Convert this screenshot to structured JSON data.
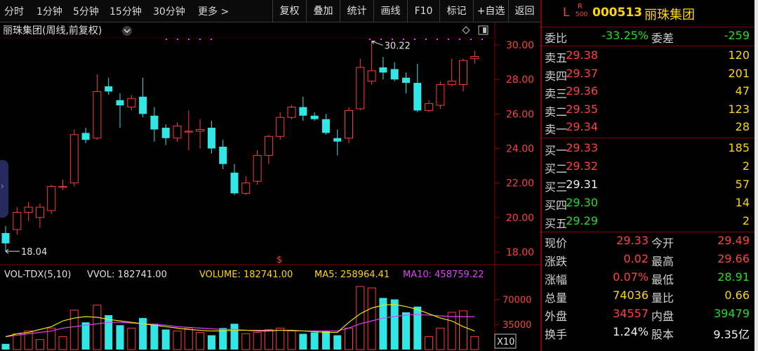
{
  "toolbar": {
    "periods": [
      "分时",
      "1分钟",
      "5分钟",
      "15分钟",
      "30分钟",
      "更多 >"
    ],
    "buttons": [
      "复权",
      "叠加",
      "统计",
      "画线",
      "F10",
      "标记",
      "+自选",
      "返回"
    ]
  },
  "chart": {
    "title": "丽珠集团(周线,前复权)",
    "high_label": "30.22",
    "low_label": "18.04",
    "price_ticks": [
      "30.00",
      "28.00",
      "26.00",
      "24.00",
      "22.00",
      "20.00",
      "18.00"
    ],
    "dollar_marker": "$"
  },
  "volume_legend": {
    "name": "VOL-TDX(5,10)",
    "vvol": "VVOL: 182741.00",
    "volume": "VOLUME: 182741.00",
    "ma5": "MA5: 258964.41",
    "ma10": "MA10: 458759.22",
    "ticks": [
      "70000",
      "35000"
    ],
    "unit": "X10"
  },
  "colors": {
    "up": "#ff3b3b",
    "down": "#33e6e6",
    "ma5": "#e8e800",
    "ma10": "#e040fb",
    "accent_red": "#8b0000"
  },
  "stock": {
    "prefix": "L",
    "badge_top": "R",
    "badge_bottom": "500",
    "code": "000513",
    "name": "丽珠集团"
  },
  "quote": {
    "weibi": {
      "label": "委比",
      "value": "-33.25%",
      "label2": "委差",
      "value2": "-259"
    },
    "asks": [
      {
        "label": "卖五",
        "price": "29.38",
        "vol": "120"
      },
      {
        "label": "卖四",
        "price": "29.37",
        "vol": "201"
      },
      {
        "label": "卖三",
        "price": "29.36",
        "vol": "47"
      },
      {
        "label": "卖二",
        "price": "29.35",
        "vol": "123"
      },
      {
        "label": "卖一",
        "price": "29.34",
        "vol": "28"
      }
    ],
    "bids": [
      {
        "label": "买一",
        "price": "29.33",
        "vol": "185"
      },
      {
        "label": "买二",
        "price": "29.32",
        "vol": "2"
      },
      {
        "label": "买三",
        "price": "29.31",
        "vol": "57"
      },
      {
        "label": "买四",
        "price": "29.30",
        "vol": "14"
      },
      {
        "label": "买五",
        "price": "29.29",
        "vol": "2"
      }
    ],
    "stats": [
      {
        "l1": "现价",
        "v1": "29.33",
        "l2": "今开",
        "v2": "29.49"
      },
      {
        "l1": "涨跌",
        "v1": "0.02",
        "l2": "最高",
        "v2": "29.66"
      },
      {
        "l1": "涨幅",
        "v1": "0.07%",
        "l2": "最低",
        "v2": "28.91"
      },
      {
        "l1": "总量",
        "v1": "74036",
        "l2": "量比",
        "v2": "0.66"
      },
      {
        "l1": "外盘",
        "v1": "34557",
        "l2": "内盘",
        "v2": "39479"
      },
      {
        "l1": "换手",
        "v1": "1.24%",
        "l2": "股本",
        "v2": "9.35亿"
      }
    ]
  },
  "chart_data": {
    "type": "candlestick",
    "title": "丽珠集团(周线,前复权)",
    "ylim": [
      17.5,
      30.6
    ],
    "candles": [
      {
        "o": 19.1,
        "h": 19.5,
        "l": 18.04,
        "c": 18.5
      },
      {
        "o": 19.3,
        "h": 20.6,
        "l": 19.0,
        "c": 20.3
      },
      {
        "o": 20.3,
        "h": 20.9,
        "l": 19.8,
        "c": 20.6
      },
      {
        "o": 20.0,
        "h": 20.8,
        "l": 19.4,
        "c": 20.6
      },
      {
        "o": 20.4,
        "h": 21.9,
        "l": 20.2,
        "c": 21.8
      },
      {
        "o": 21.8,
        "h": 22.2,
        "l": 21.6,
        "c": 21.8
      },
      {
        "o": 22.0,
        "h": 25.1,
        "l": 21.8,
        "c": 24.8
      },
      {
        "o": 24.9,
        "h": 25.2,
        "l": 24.3,
        "c": 24.5
      },
      {
        "o": 24.6,
        "h": 28.3,
        "l": 24.5,
        "c": 27.3
      },
      {
        "o": 27.6,
        "h": 28.1,
        "l": 27.1,
        "c": 27.3
      },
      {
        "o": 26.8,
        "h": 27.2,
        "l": 25.2,
        "c": 26.5
      },
      {
        "o": 26.4,
        "h": 27.1,
        "l": 26.2,
        "c": 26.9
      },
      {
        "o": 27.0,
        "h": 28.1,
        "l": 25.8,
        "c": 26.0
      },
      {
        "o": 25.9,
        "h": 26.4,
        "l": 24.4,
        "c": 25.1
      },
      {
        "o": 25.2,
        "h": 25.4,
        "l": 24.2,
        "c": 24.6
      },
      {
        "o": 24.6,
        "h": 25.5,
        "l": 24.4,
        "c": 25.3
      },
      {
        "o": 25.0,
        "h": 26.2,
        "l": 23.9,
        "c": 25.0
      },
      {
        "o": 25.0,
        "h": 25.7,
        "l": 24.0,
        "c": 25.1
      },
      {
        "o": 25.2,
        "h": 25.6,
        "l": 23.7,
        "c": 24.0
      },
      {
        "o": 24.1,
        "h": 24.5,
        "l": 22.8,
        "c": 23.1
      },
      {
        "o": 22.6,
        "h": 23.1,
        "l": 21.3,
        "c": 21.4
      },
      {
        "o": 21.4,
        "h": 22.4,
        "l": 21.3,
        "c": 22.0
      },
      {
        "o": 22.1,
        "h": 23.9,
        "l": 21.9,
        "c": 23.6
      },
      {
        "o": 23.6,
        "h": 24.8,
        "l": 23.1,
        "c": 24.7
      },
      {
        "o": 24.7,
        "h": 26.1,
        "l": 24.5,
        "c": 25.8
      },
      {
        "o": 25.8,
        "h": 26.5,
        "l": 25.7,
        "c": 26.4
      },
      {
        "o": 26.4,
        "h": 27.0,
        "l": 25.6,
        "c": 25.9
      },
      {
        "o": 25.9,
        "h": 26.1,
        "l": 25.6,
        "c": 25.7
      },
      {
        "o": 25.7,
        "h": 26.0,
        "l": 24.8,
        "c": 24.9
      },
      {
        "o": 24.6,
        "h": 25.1,
        "l": 23.6,
        "c": 24.4
      },
      {
        "o": 24.6,
        "h": 26.4,
        "l": 24.3,
        "c": 26.2
      },
      {
        "o": 26.3,
        "h": 29.2,
        "l": 26.2,
        "c": 28.7
      },
      {
        "o": 27.9,
        "h": 30.22,
        "l": 27.7,
        "c": 28.5
      },
      {
        "o": 28.7,
        "h": 29.3,
        "l": 28.0,
        "c": 28.4
      },
      {
        "o": 28.6,
        "h": 29.0,
        "l": 27.9,
        "c": 28.0
      },
      {
        "o": 28.1,
        "h": 28.4,
        "l": 27.2,
        "c": 27.8
      },
      {
        "o": 27.8,
        "h": 28.9,
        "l": 26.1,
        "c": 26.2
      },
      {
        "o": 26.2,
        "h": 26.8,
        "l": 26.1,
        "c": 26.6
      },
      {
        "o": 26.5,
        "h": 27.9,
        "l": 26.3,
        "c": 27.7
      },
      {
        "o": 27.7,
        "h": 29.2,
        "l": 27.6,
        "c": 27.9
      },
      {
        "o": 27.7,
        "h": 29.2,
        "l": 27.3,
        "c": 29.1
      },
      {
        "o": 29.2,
        "h": 29.66,
        "l": 28.91,
        "c": 29.33
      }
    ],
    "volume": {
      "unit": "X10",
      "ylim": [
        0,
        92000
      ],
      "values": [
        8000,
        22000,
        26000,
        14000,
        30000,
        18000,
        55000,
        38000,
        62000,
        48000,
        34000,
        30000,
        44000,
        36000,
        28000,
        26000,
        30000,
        24000,
        20000,
        30000,
        36000,
        22000,
        24000,
        28000,
        30000,
        26000,
        22000,
        24000,
        26000,
        20000,
        30000,
        88000,
        86000,
        72000,
        70000,
        52000,
        60000,
        18000,
        30000,
        52000,
        54000,
        18274
      ],
      "ma5": [
        18000,
        22000,
        24000,
        28000,
        32000,
        40000,
        44000,
        46000,
        45000,
        42000,
        40000,
        38000,
        36000,
        34000,
        32000,
        30000,
        28000,
        27000,
        26000,
        26000,
        27000,
        27000,
        26000,
        26000,
        27000,
        27000,
        26000,
        25000,
        24000,
        24000,
        38000,
        50000,
        58000,
        62000,
        63000,
        60000,
        56000,
        50000,
        44000,
        40000,
        32000,
        25896
      ],
      "ma10": [
        18000,
        20000,
        22000,
        24000,
        26000,
        30000,
        32000,
        34000,
        36000,
        38000,
        38000,
        37000,
        36000,
        35000,
        34000,
        32000,
        31000,
        30000,
        29000,
        28000,
        28000,
        27000,
        27000,
        27000,
        27000,
        26000,
        26000,
        26000,
        26000,
        26000,
        30000,
        36000,
        40000,
        44000,
        46000,
        48000,
        49000,
        48000,
        47000,
        46000,
        46000,
        45876
      ]
    }
  }
}
